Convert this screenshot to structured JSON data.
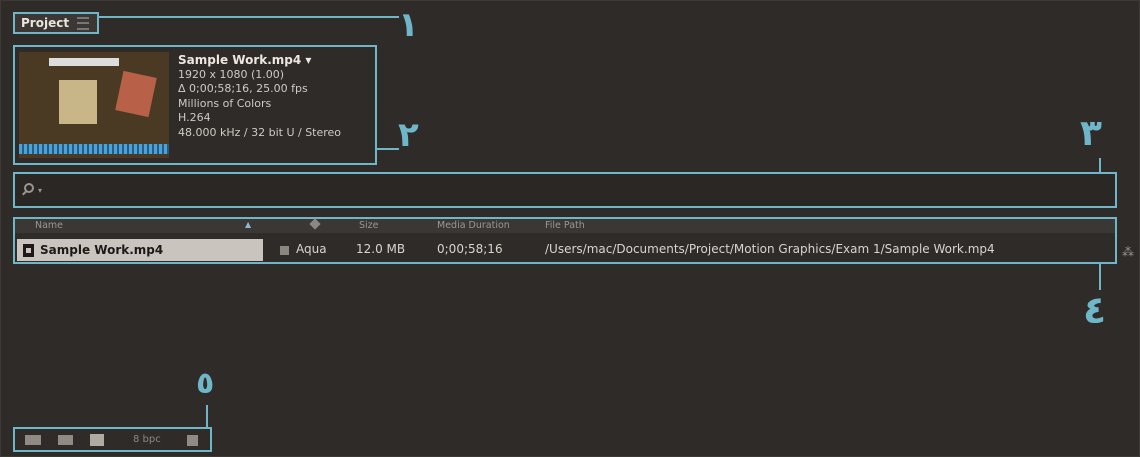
{
  "panel": {
    "title": "Project"
  },
  "footage": {
    "name": "Sample Work.mp4",
    "resolution": "1920 x 1080 (1.00)",
    "duration_fps": "Δ 0;00;58;16, 25.00 fps",
    "colors": "Millions of Colors",
    "codec": "H.264",
    "audio": "48.000 kHz / 32 bit U / Stereo"
  },
  "search": {
    "placeholder": ""
  },
  "columns": {
    "name": "Name",
    "size": "Size",
    "media_duration": "Media Duration",
    "file_path": "File Path"
  },
  "rows": [
    {
      "name": "Sample Work.mp4",
      "label": "Aqua",
      "size": "12.0 MB",
      "media_duration": "0;00;58;16",
      "file_path": "/Users/mac/Documents/Project/Motion Graphics/Exam 1/Sample Work.mp4"
    }
  ],
  "bottom": {
    "bit_depth": "8 bpc"
  },
  "callouts": [
    "١",
    "٢",
    "٣",
    "٤",
    "٥"
  ],
  "colors": {
    "accent": "#6fb6c9",
    "background": "#2e2b29",
    "selection": "#c9c4be"
  },
  "icons": {
    "panel_menu": "menu-icon",
    "search": "search-icon",
    "label_header": "tag-icon",
    "interpret": "interpret-footage-icon",
    "folder": "new-folder-icon",
    "composition": "new-composition-icon",
    "trash": "trash-icon",
    "flowchart": "flowchart-icon"
  }
}
